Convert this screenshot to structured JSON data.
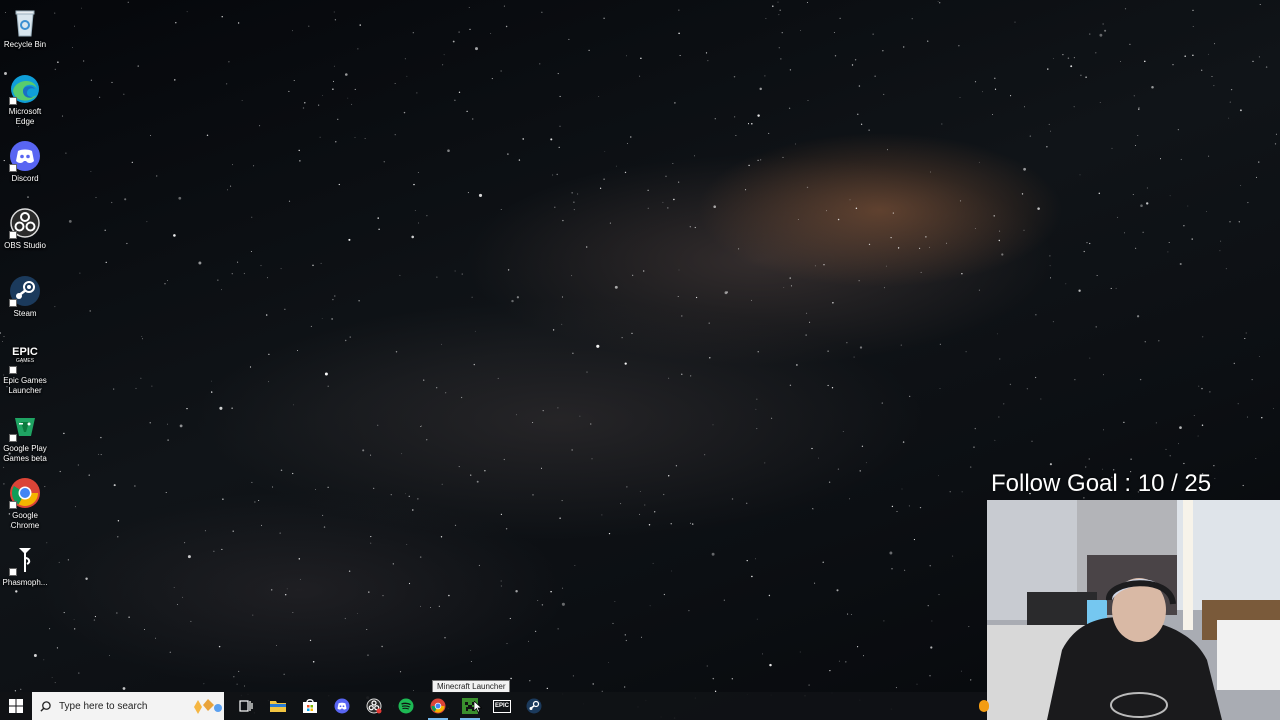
{
  "desktop": {
    "icons": [
      {
        "label": "Recycle Bin",
        "icon": "recycle-bin-icon"
      },
      {
        "label": "Microsoft Edge",
        "icon": "edge-icon"
      },
      {
        "label": "Discord",
        "icon": "discord-icon"
      },
      {
        "label": "OBS Studio",
        "icon": "obs-icon"
      },
      {
        "label": "Steam",
        "icon": "steam-icon"
      },
      {
        "label": "Epic Games Launcher",
        "icon": "epic-games-icon",
        "glyph_text": "EPIC",
        "glyph_sub": "GAMES"
      },
      {
        "label": "Google Play Games beta",
        "icon": "google-play-games-icon"
      },
      {
        "label": "Google Chrome",
        "icon": "chrome-icon"
      },
      {
        "label": "Phasmoph...",
        "icon": "phasmophobia-icon"
      }
    ]
  },
  "overlay": {
    "follow_goal": "Follow Goal : 10 / 25",
    "webcam": "webcam-feed"
  },
  "taskbar": {
    "search_placeholder": "Type here to search",
    "tooltip": "Minecraft Launcher",
    "apps": [
      {
        "name": "Task View",
        "icon": "task-view-icon"
      },
      {
        "name": "File Explorer",
        "icon": "folder-icon"
      },
      {
        "name": "Microsoft Store",
        "icon": "store-icon"
      },
      {
        "name": "Discord",
        "icon": "discord-icon"
      },
      {
        "name": "OBS Studio",
        "icon": "obs-icon"
      },
      {
        "name": "Spotify",
        "icon": "spotify-icon"
      },
      {
        "name": "Google Chrome",
        "icon": "chrome-icon",
        "active": true
      },
      {
        "name": "Minecraft Launcher",
        "icon": "minecraft-icon",
        "active": true
      },
      {
        "name": "Epic Games Launcher",
        "icon": "epic-games-icon",
        "glyph_text": "EPIC"
      },
      {
        "name": "Steam",
        "icon": "steam-icon"
      }
    ]
  },
  "colors": {
    "taskbar": "#101216",
    "accent": "#76b9ed",
    "discord": "#5865f2",
    "spotify": "#1db954",
    "edge": "#0f9ed8"
  }
}
